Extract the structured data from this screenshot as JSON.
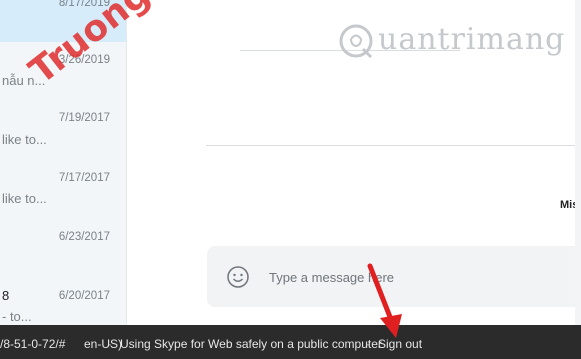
{
  "conversations": [
    {
      "date": "8/17/2019",
      "snippet": "",
      "selected": true
    },
    {
      "date": "3/26/2019",
      "snippet": "nẫu n..."
    },
    {
      "date": "7/19/2017",
      "snippet": "like to..."
    },
    {
      "date": "7/17/2017",
      "snippet": "like to..."
    },
    {
      "date": "6/23/2017",
      "snippet": ""
    },
    {
      "date": "6/20/2017",
      "name_fragment": "8",
      "snippet": "- to..."
    }
  ],
  "main": {
    "partial_name": "Mis",
    "composer": {
      "placeholder": "Type a message here"
    }
  },
  "footer": {
    "url_fragment": "/8-51-0-72/#",
    "locale_fragment": "en-US)",
    "separator": "·",
    "safety_link": "Using Skype for Web safely on a public computer",
    "sign_out": "Sign out"
  },
  "watermarks": {
    "red_text": "Truongtin.top",
    "brand_text": "uantrimang"
  },
  "colors": {
    "selected_bg": "#d6ecfb",
    "footer_bg": "#2b2b2b",
    "composer_bg": "#f1f3f5",
    "arrow": "#e02020"
  }
}
